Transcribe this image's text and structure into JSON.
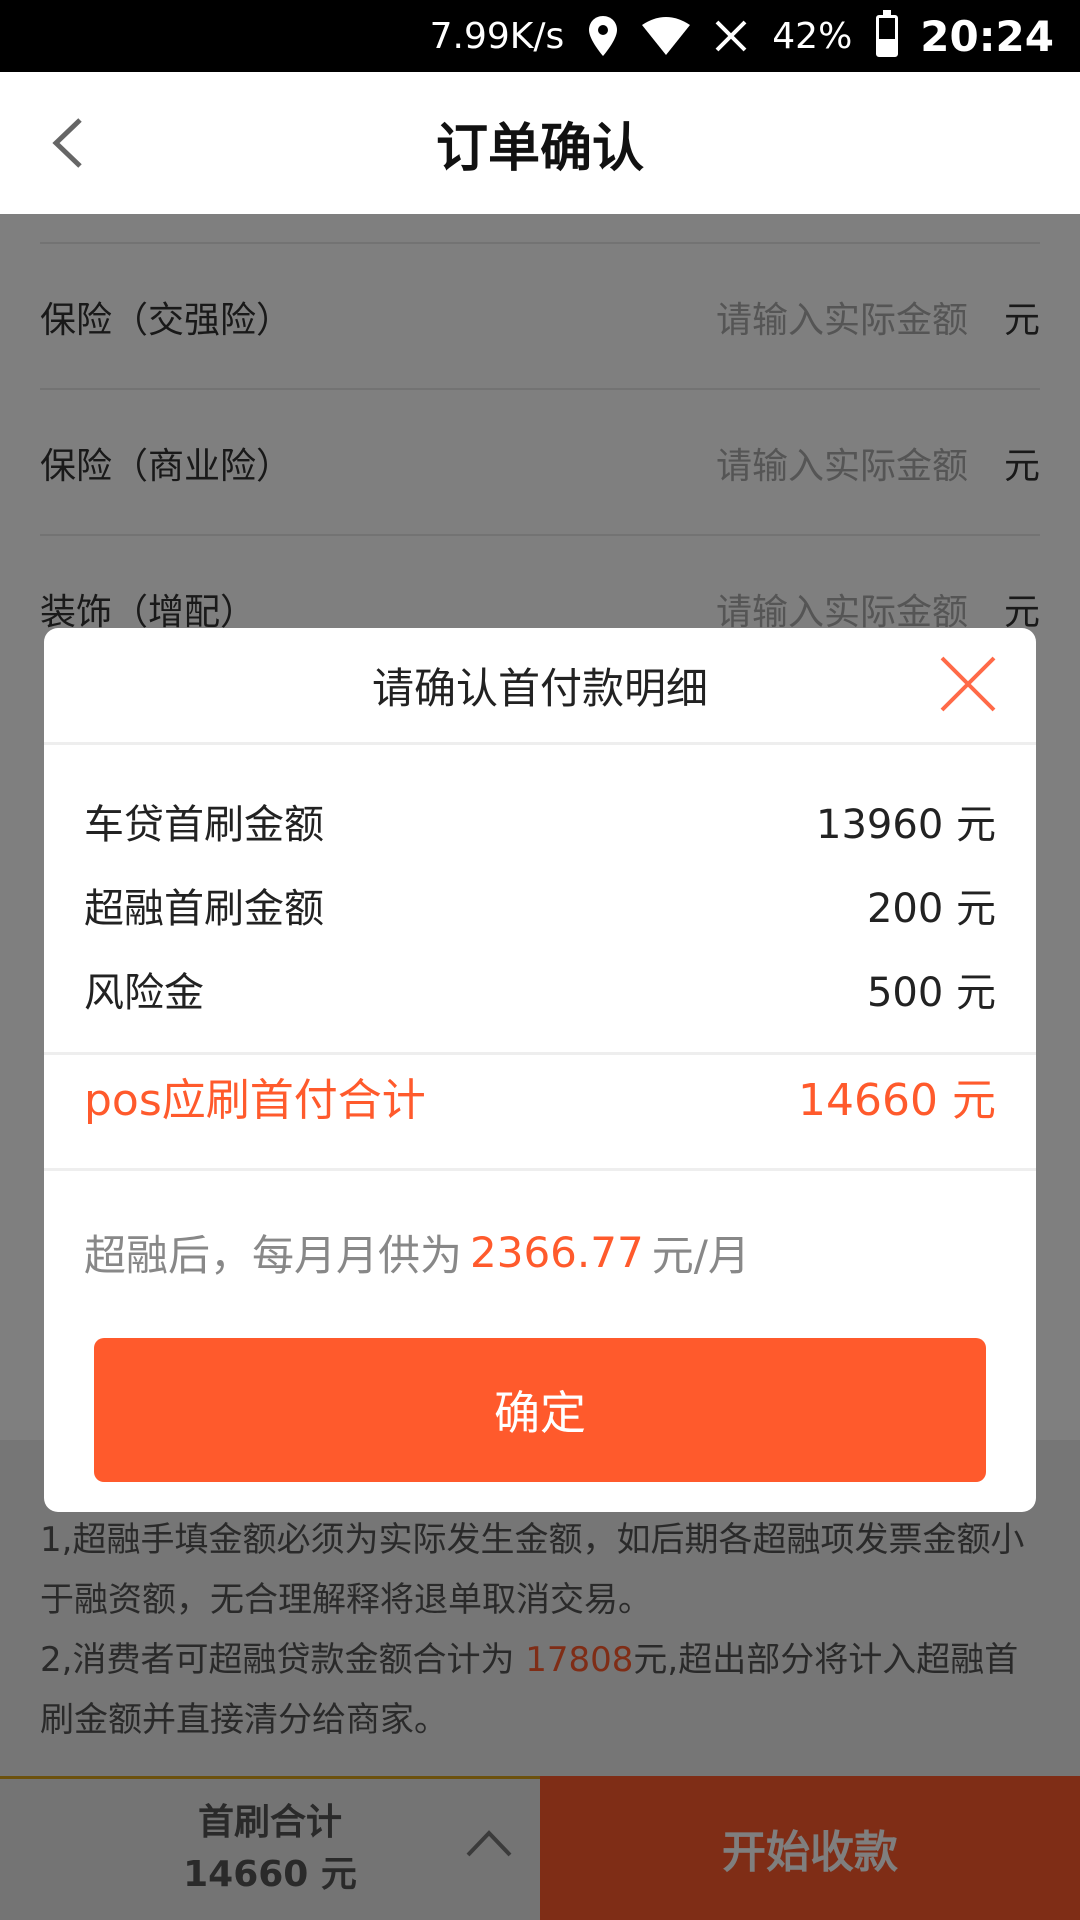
{
  "status_bar": {
    "net_speed": "7.99K/s",
    "battery_pct": "42%",
    "battery_level": 0.42,
    "time": "20:24",
    "icons": [
      "location-icon",
      "wifi-icon",
      "no-signal-icon",
      "battery-icon"
    ]
  },
  "header": {
    "title": "订单确认",
    "back_icon": "chevron-left-icon"
  },
  "form": {
    "rows": [
      {
        "label": "保险（交强险）",
        "placeholder": "请输入实际金额",
        "unit": "元"
      },
      {
        "label": "保险（商业险）",
        "placeholder": "请输入实际金额",
        "unit": "元"
      },
      {
        "label": "装饰（增配）",
        "placeholder": "请输入实际金额",
        "unit": "元"
      }
    ]
  },
  "notes": {
    "line1": "1,超融手填金额必须为实际发生金额，如后期各超融项发票金额小于融资额，无合理解释将退单取消交易。",
    "line2_prefix": "2,消费者可超融贷款金额合计为 ",
    "line2_amount": "17808",
    "line2_suffix": "元,超出部分将计入超融首刷金额并直接清分给商家。"
  },
  "modal": {
    "title": "请确认首付款明细",
    "close_icon": "close-icon",
    "details": [
      {
        "label": "车贷首刷金额",
        "value": "13960 元"
      },
      {
        "label": "超融首刷金额",
        "value": "200 元"
      },
      {
        "label": "风险金",
        "value": "500 元"
      }
    ],
    "total_label": "pos应刷首付合计",
    "total_value": "14660 元",
    "monthly_prefix": "超融后，每月月供为",
    "monthly_value": "2366.77",
    "monthly_suffix": "元/月",
    "confirm_label": "确定"
  },
  "bottom_bar": {
    "summary_label": "首刷合计",
    "summary_value": "14660 元",
    "expand_icon": "chevron-up-icon",
    "action_label": "开始收款"
  },
  "colors": {
    "accent": "#ff5a2c",
    "status_bar": "#000000",
    "divider": "#eeeeee"
  }
}
